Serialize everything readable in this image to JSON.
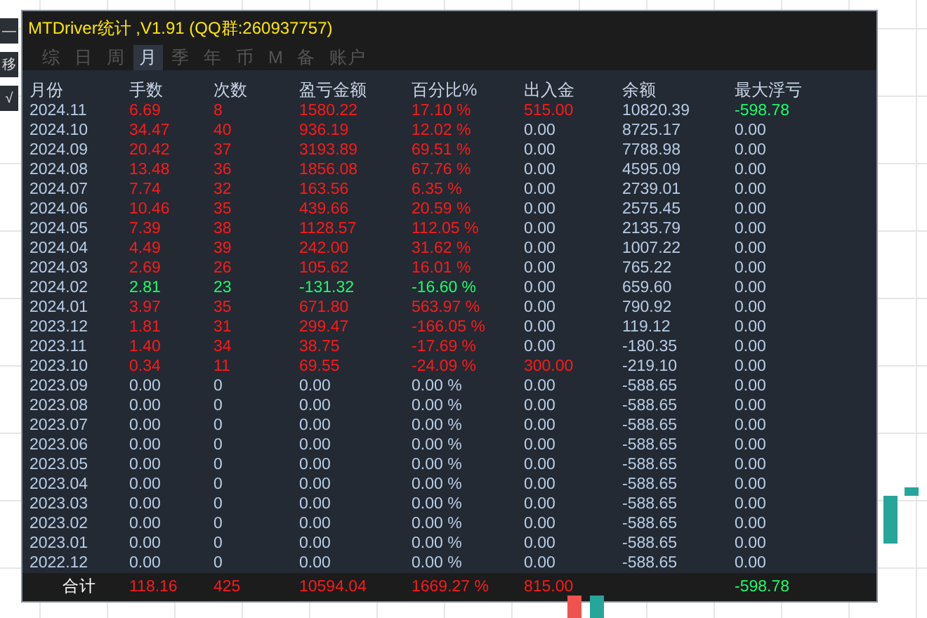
{
  "side_buttons": [
    "—",
    "移",
    "√"
  ],
  "panel": {
    "title": "MTDriver统计 ,V1.91 (QQ群:260937757)",
    "tabs": [
      {
        "label": "综",
        "selected": false
      },
      {
        "label": "日",
        "selected": false
      },
      {
        "label": "周",
        "selected": false
      },
      {
        "label": "月",
        "selected": true
      },
      {
        "label": "季",
        "selected": false
      },
      {
        "label": "年",
        "selected": false
      },
      {
        "label": "币",
        "selected": false
      },
      {
        "label": "M",
        "selected": false
      },
      {
        "label": "备",
        "selected": false
      },
      {
        "label": "账户",
        "selected": false
      }
    ]
  },
  "table": {
    "columns": [
      "月份",
      "手数",
      "次数",
      "盈亏金额",
      "百分比%",
      "出入金",
      "余额",
      "最大浮亏"
    ],
    "rows": [
      {
        "cells": [
          {
            "text": "2024.11",
            "color": "#b8cce6"
          },
          {
            "text": "6.69",
            "color": "#ff1a1a"
          },
          {
            "text": "8",
            "color": "#ff1a1a"
          },
          {
            "text": "1580.22",
            "color": "#ff1a1a"
          },
          {
            "text": "17.10 %",
            "color": "#ff1a1a"
          },
          {
            "text": "515.00",
            "color": "#ff1a1a"
          },
          {
            "text": "10820.39",
            "color": "#b8cce6"
          },
          {
            "text": "-598.78",
            "color": "#1aff6a"
          }
        ]
      },
      {
        "cells": [
          {
            "text": "2024.10",
            "color": "#b8cce6"
          },
          {
            "text": "34.47",
            "color": "#ff1a1a"
          },
          {
            "text": "40",
            "color": "#ff1a1a"
          },
          {
            "text": "936.19",
            "color": "#ff1a1a"
          },
          {
            "text": "12.02 %",
            "color": "#ff1a1a"
          },
          {
            "text": "0.00",
            "color": "#b8cce6"
          },
          {
            "text": "8725.17",
            "color": "#b8cce6"
          },
          {
            "text": "0.00",
            "color": "#b8cce6"
          }
        ]
      },
      {
        "cells": [
          {
            "text": "2024.09",
            "color": "#b8cce6"
          },
          {
            "text": "20.42",
            "color": "#ff1a1a"
          },
          {
            "text": "37",
            "color": "#ff1a1a"
          },
          {
            "text": "3193.89",
            "color": "#ff1a1a"
          },
          {
            "text": "69.51 %",
            "color": "#ff1a1a"
          },
          {
            "text": "0.00",
            "color": "#b8cce6"
          },
          {
            "text": "7788.98",
            "color": "#b8cce6"
          },
          {
            "text": "0.00",
            "color": "#b8cce6"
          }
        ]
      },
      {
        "cells": [
          {
            "text": "2024.08",
            "color": "#b8cce6"
          },
          {
            "text": "13.48",
            "color": "#ff1a1a"
          },
          {
            "text": "36",
            "color": "#ff1a1a"
          },
          {
            "text": "1856.08",
            "color": "#ff1a1a"
          },
          {
            "text": "67.76 %",
            "color": "#ff1a1a"
          },
          {
            "text": "0.00",
            "color": "#b8cce6"
          },
          {
            "text": "4595.09",
            "color": "#b8cce6"
          },
          {
            "text": "0.00",
            "color": "#b8cce6"
          }
        ]
      },
      {
        "cells": [
          {
            "text": "2024.07",
            "color": "#b8cce6"
          },
          {
            "text": "7.74",
            "color": "#ff1a1a"
          },
          {
            "text": "32",
            "color": "#ff1a1a"
          },
          {
            "text": "163.56",
            "color": "#ff1a1a"
          },
          {
            "text": "6.35 %",
            "color": "#ff1a1a"
          },
          {
            "text": "0.00",
            "color": "#b8cce6"
          },
          {
            "text": "2739.01",
            "color": "#b8cce6"
          },
          {
            "text": "0.00",
            "color": "#b8cce6"
          }
        ]
      },
      {
        "cells": [
          {
            "text": "2024.06",
            "color": "#b8cce6"
          },
          {
            "text": "10.46",
            "color": "#ff1a1a"
          },
          {
            "text": "35",
            "color": "#ff1a1a"
          },
          {
            "text": "439.66",
            "color": "#ff1a1a"
          },
          {
            "text": "20.59 %",
            "color": "#ff1a1a"
          },
          {
            "text": "0.00",
            "color": "#b8cce6"
          },
          {
            "text": "2575.45",
            "color": "#b8cce6"
          },
          {
            "text": "0.00",
            "color": "#b8cce6"
          }
        ]
      },
      {
        "cells": [
          {
            "text": "2024.05",
            "color": "#b8cce6"
          },
          {
            "text": "7.39",
            "color": "#ff1a1a"
          },
          {
            "text": "38",
            "color": "#ff1a1a"
          },
          {
            "text": "1128.57",
            "color": "#ff1a1a"
          },
          {
            "text": "112.05 %",
            "color": "#ff1a1a"
          },
          {
            "text": "0.00",
            "color": "#b8cce6"
          },
          {
            "text": "2135.79",
            "color": "#b8cce6"
          },
          {
            "text": "0.00",
            "color": "#b8cce6"
          }
        ]
      },
      {
        "cells": [
          {
            "text": "2024.04",
            "color": "#b8cce6"
          },
          {
            "text": "4.49",
            "color": "#ff1a1a"
          },
          {
            "text": "39",
            "color": "#ff1a1a"
          },
          {
            "text": "242.00",
            "color": "#ff1a1a"
          },
          {
            "text": "31.62 %",
            "color": "#ff1a1a"
          },
          {
            "text": "0.00",
            "color": "#b8cce6"
          },
          {
            "text": "1007.22",
            "color": "#b8cce6"
          },
          {
            "text": "0.00",
            "color": "#b8cce6"
          }
        ]
      },
      {
        "cells": [
          {
            "text": "2024.03",
            "color": "#b8cce6"
          },
          {
            "text": "2.69",
            "color": "#ff1a1a"
          },
          {
            "text": "26",
            "color": "#ff1a1a"
          },
          {
            "text": "105.62",
            "color": "#ff1a1a"
          },
          {
            "text": "16.01 %",
            "color": "#ff1a1a"
          },
          {
            "text": "0.00",
            "color": "#b8cce6"
          },
          {
            "text": "765.22",
            "color": "#b8cce6"
          },
          {
            "text": "0.00",
            "color": "#b8cce6"
          }
        ]
      },
      {
        "cells": [
          {
            "text": "2024.02",
            "color": "#b8cce6"
          },
          {
            "text": "2.81",
            "color": "#1aff6a"
          },
          {
            "text": "23",
            "color": "#1aff6a"
          },
          {
            "text": "-131.32",
            "color": "#1aff6a"
          },
          {
            "text": "-16.60 %",
            "color": "#1aff6a"
          },
          {
            "text": "0.00",
            "color": "#b8cce6"
          },
          {
            "text": "659.60",
            "color": "#b8cce6"
          },
          {
            "text": "0.00",
            "color": "#b8cce6"
          }
        ]
      },
      {
        "cells": [
          {
            "text": "2024.01",
            "color": "#b8cce6"
          },
          {
            "text": "3.97",
            "color": "#ff1a1a"
          },
          {
            "text": "35",
            "color": "#ff1a1a"
          },
          {
            "text": "671.80",
            "color": "#ff1a1a"
          },
          {
            "text": "563.97 %",
            "color": "#ff1a1a"
          },
          {
            "text": "0.00",
            "color": "#b8cce6"
          },
          {
            "text": "790.92",
            "color": "#b8cce6"
          },
          {
            "text": "0.00",
            "color": "#b8cce6"
          }
        ]
      },
      {
        "cells": [
          {
            "text": "2023.12",
            "color": "#b8cce6"
          },
          {
            "text": "1.81",
            "color": "#ff1a1a"
          },
          {
            "text": "31",
            "color": "#ff1a1a"
          },
          {
            "text": "299.47",
            "color": "#ff1a1a"
          },
          {
            "text": "-166.05 %",
            "color": "#ff1a1a"
          },
          {
            "text": "0.00",
            "color": "#b8cce6"
          },
          {
            "text": "119.12",
            "color": "#b8cce6"
          },
          {
            "text": "0.00",
            "color": "#b8cce6"
          }
        ]
      },
      {
        "cells": [
          {
            "text": "2023.11",
            "color": "#b8cce6"
          },
          {
            "text": "1.40",
            "color": "#ff1a1a"
          },
          {
            "text": "34",
            "color": "#ff1a1a"
          },
          {
            "text": "38.75",
            "color": "#ff1a1a"
          },
          {
            "text": "-17.69 %",
            "color": "#ff1a1a"
          },
          {
            "text": "0.00",
            "color": "#b8cce6"
          },
          {
            "text": "-180.35",
            "color": "#b8cce6"
          },
          {
            "text": "0.00",
            "color": "#b8cce6"
          }
        ]
      },
      {
        "cells": [
          {
            "text": "2023.10",
            "color": "#b8cce6"
          },
          {
            "text": "0.34",
            "color": "#ff1a1a"
          },
          {
            "text": "11",
            "color": "#ff1a1a"
          },
          {
            "text": "69.55",
            "color": "#ff1a1a"
          },
          {
            "text": "-24.09 %",
            "color": "#ff1a1a"
          },
          {
            "text": "300.00",
            "color": "#ff1a1a"
          },
          {
            "text": "-219.10",
            "color": "#b8cce6"
          },
          {
            "text": "0.00",
            "color": "#b8cce6"
          }
        ]
      },
      {
        "cells": [
          {
            "text": "2023.09",
            "color": "#b8cce6"
          },
          {
            "text": "0.00",
            "color": "#b8cce6"
          },
          {
            "text": "0",
            "color": "#b8cce6"
          },
          {
            "text": "0.00",
            "color": "#b8cce6"
          },
          {
            "text": "0.00 %",
            "color": "#b8cce6"
          },
          {
            "text": "0.00",
            "color": "#b8cce6"
          },
          {
            "text": "-588.65",
            "color": "#b8cce6"
          },
          {
            "text": "0.00",
            "color": "#b8cce6"
          }
        ]
      },
      {
        "cells": [
          {
            "text": "2023.08",
            "color": "#b8cce6"
          },
          {
            "text": "0.00",
            "color": "#b8cce6"
          },
          {
            "text": "0",
            "color": "#b8cce6"
          },
          {
            "text": "0.00",
            "color": "#b8cce6"
          },
          {
            "text": "0.00 %",
            "color": "#b8cce6"
          },
          {
            "text": "0.00",
            "color": "#b8cce6"
          },
          {
            "text": "-588.65",
            "color": "#b8cce6"
          },
          {
            "text": "0.00",
            "color": "#b8cce6"
          }
        ]
      },
      {
        "cells": [
          {
            "text": "2023.07",
            "color": "#b8cce6"
          },
          {
            "text": "0.00",
            "color": "#b8cce6"
          },
          {
            "text": "0",
            "color": "#b8cce6"
          },
          {
            "text": "0.00",
            "color": "#b8cce6"
          },
          {
            "text": "0.00 %",
            "color": "#b8cce6"
          },
          {
            "text": "0.00",
            "color": "#b8cce6"
          },
          {
            "text": "-588.65",
            "color": "#b8cce6"
          },
          {
            "text": "0.00",
            "color": "#b8cce6"
          }
        ]
      },
      {
        "cells": [
          {
            "text": "2023.06",
            "color": "#b8cce6"
          },
          {
            "text": "0.00",
            "color": "#b8cce6"
          },
          {
            "text": "0",
            "color": "#b8cce6"
          },
          {
            "text": "0.00",
            "color": "#b8cce6"
          },
          {
            "text": "0.00 %",
            "color": "#b8cce6"
          },
          {
            "text": "0.00",
            "color": "#b8cce6"
          },
          {
            "text": "-588.65",
            "color": "#b8cce6"
          },
          {
            "text": "0.00",
            "color": "#b8cce6"
          }
        ]
      },
      {
        "cells": [
          {
            "text": "2023.05",
            "color": "#b8cce6"
          },
          {
            "text": "0.00",
            "color": "#b8cce6"
          },
          {
            "text": "0",
            "color": "#b8cce6"
          },
          {
            "text": "0.00",
            "color": "#b8cce6"
          },
          {
            "text": "0.00 %",
            "color": "#b8cce6"
          },
          {
            "text": "0.00",
            "color": "#b8cce6"
          },
          {
            "text": "-588.65",
            "color": "#b8cce6"
          },
          {
            "text": "0.00",
            "color": "#b8cce6"
          }
        ]
      },
      {
        "cells": [
          {
            "text": "2023.04",
            "color": "#b8cce6"
          },
          {
            "text": "0.00",
            "color": "#b8cce6"
          },
          {
            "text": "0",
            "color": "#b8cce6"
          },
          {
            "text": "0.00",
            "color": "#b8cce6"
          },
          {
            "text": "0.00 %",
            "color": "#b8cce6"
          },
          {
            "text": "0.00",
            "color": "#b8cce6"
          },
          {
            "text": "-588.65",
            "color": "#b8cce6"
          },
          {
            "text": "0.00",
            "color": "#b8cce6"
          }
        ]
      },
      {
        "cells": [
          {
            "text": "2023.03",
            "color": "#b8cce6"
          },
          {
            "text": "0.00",
            "color": "#b8cce6"
          },
          {
            "text": "0",
            "color": "#b8cce6"
          },
          {
            "text": "0.00",
            "color": "#b8cce6"
          },
          {
            "text": "0.00 %",
            "color": "#b8cce6"
          },
          {
            "text": "0.00",
            "color": "#b8cce6"
          },
          {
            "text": "-588.65",
            "color": "#b8cce6"
          },
          {
            "text": "0.00",
            "color": "#b8cce6"
          }
        ]
      },
      {
        "cells": [
          {
            "text": "2023.02",
            "color": "#b8cce6"
          },
          {
            "text": "0.00",
            "color": "#b8cce6"
          },
          {
            "text": "0",
            "color": "#b8cce6"
          },
          {
            "text": "0.00",
            "color": "#b8cce6"
          },
          {
            "text": "0.00 %",
            "color": "#b8cce6"
          },
          {
            "text": "0.00",
            "color": "#b8cce6"
          },
          {
            "text": "-588.65",
            "color": "#b8cce6"
          },
          {
            "text": "0.00",
            "color": "#b8cce6"
          }
        ]
      },
      {
        "cells": [
          {
            "text": "2023.01",
            "color": "#b8cce6"
          },
          {
            "text": "0.00",
            "color": "#b8cce6"
          },
          {
            "text": "0",
            "color": "#b8cce6"
          },
          {
            "text": "0.00",
            "color": "#b8cce6"
          },
          {
            "text": "0.00 %",
            "color": "#b8cce6"
          },
          {
            "text": "0.00",
            "color": "#b8cce6"
          },
          {
            "text": "-588.65",
            "color": "#b8cce6"
          },
          {
            "text": "0.00",
            "color": "#b8cce6"
          }
        ]
      },
      {
        "cells": [
          {
            "text": "2022.12",
            "color": "#b8cce6"
          },
          {
            "text": "0.00",
            "color": "#b8cce6"
          },
          {
            "text": "0",
            "color": "#b8cce6"
          },
          {
            "text": "0.00",
            "color": "#b8cce6"
          },
          {
            "text": "0.00 %",
            "color": "#b8cce6"
          },
          {
            "text": "0.00",
            "color": "#b8cce6"
          },
          {
            "text": "-588.65",
            "color": "#b8cce6"
          },
          {
            "text": "0.00",
            "color": "#b8cce6"
          }
        ]
      }
    ],
    "total": {
      "cells": [
        {
          "text": "合计",
          "color": "#ffffff"
        },
        {
          "text": "118.16",
          "color": "#ff1a1a"
        },
        {
          "text": "425",
          "color": "#ff1a1a"
        },
        {
          "text": "10594.04",
          "color": "#ff1a1a"
        },
        {
          "text": "1669.27 %",
          "color": "#ff1a1a"
        },
        {
          "text": "815.00",
          "color": "#ff1a1a"
        }
      ],
      "max_drawdown": {
        "text": "-598.78",
        "color": "#1aff6a"
      }
    }
  }
}
